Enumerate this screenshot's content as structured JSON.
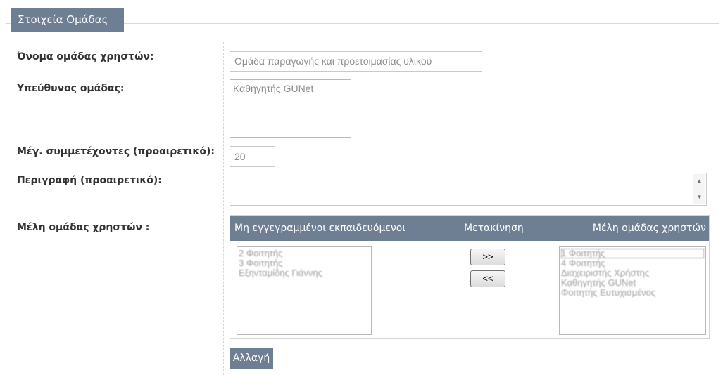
{
  "fieldset": {
    "legend": "Στοιχεία Ομάδας"
  },
  "fields": {
    "group_name": {
      "label": "Όνομα ομάδας χρηστών:",
      "value": "Ομάδα παραγωγής και προετοιμασίας υλικού"
    },
    "tutor": {
      "label": "Υπεύθυνος ομάδας:",
      "options": [
        "Καθηγητής GUNet"
      ]
    },
    "max_members": {
      "label": "Μέγ. συμμετέχοντες (προαιρετικό):",
      "value": "20"
    },
    "description": {
      "label": "Περιγραφή (προαιρετικό):",
      "value": ""
    },
    "members": {
      "label": "Μέλη ομάδας χρηστών :"
    }
  },
  "members_table": {
    "headers": {
      "unregistered": "Μη εγγεγραμμένοι εκπαιδευόμενοι",
      "move": "Μετακίνηση",
      "members": "Μέλη ομάδας χρηστών"
    },
    "unregistered_list": [
      "2 Φοιτητής",
      "3 Φοιτητής",
      "Εξηνταμίδης Γιάννης"
    ],
    "members_list": [
      "1 Φοιτητής",
      "4 Φοιτητής",
      "Διαχειριστής Χρήστης",
      "Καθηγητής GUNet",
      "Φοιτητής Ευτυχισμένος"
    ],
    "add_button": ">>",
    "remove_button": "<<"
  },
  "submit_label": "Αλλαγή",
  "colors": {
    "accent": "#6f7f93",
    "border": "#c9c9c9",
    "muted_text": "#8c8c8c"
  }
}
